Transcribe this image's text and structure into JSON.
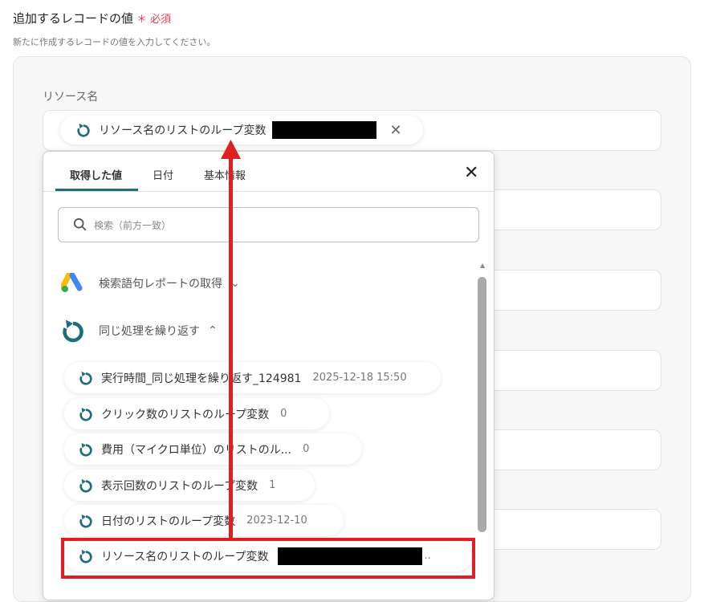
{
  "header": {
    "title": "追加するレコードの値",
    "required": "＊ 必須",
    "subtitle": "新たに作成するレコードの値を入力してください。"
  },
  "field": {
    "label": "リソース名",
    "chip_label": "リソース名のリストのループ変数"
  },
  "popup": {
    "tabs": [
      "取得した値",
      "日付",
      "基本情報"
    ],
    "search_placeholder": "検索（前方一致）",
    "sections": [
      {
        "label": "検索語句レポートの取得"
      },
      {
        "label": "同じ処理を繰り返す"
      }
    ],
    "items": [
      {
        "label": "実行時間_同じ処理を繰り返す_124981",
        "value": "2025-12-18 15:50"
      },
      {
        "label": "クリック数のリストのループ変数",
        "value": "0"
      },
      {
        "label": "費用（マイクロ単位）のリストのル...",
        "value": "0"
      },
      {
        "label": "表示回数のリストのループ変数",
        "value": "1"
      },
      {
        "label": "日付のリストのループ変数",
        "value": "2023-12-10"
      },
      {
        "label": "リソース名のリストのループ変数",
        "value": ".."
      }
    ]
  },
  "colors": {
    "accent": "#1d6d7e",
    "required": "#e8384f",
    "annotation": "#e02020"
  }
}
